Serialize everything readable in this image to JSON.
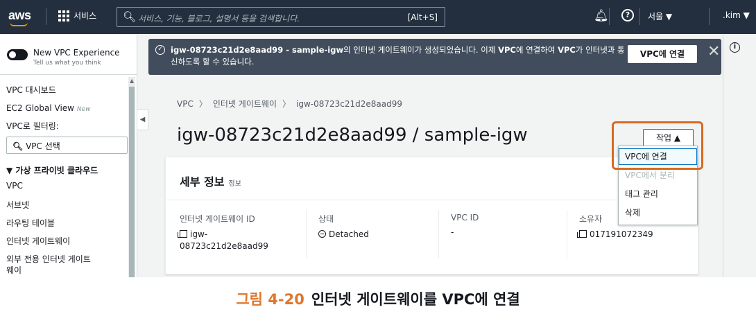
{
  "topnav": {
    "logo": "aws",
    "services": "서비스",
    "search_placeholder": "서비스, 기능, 블로그, 설명서 등을 검색합니다.",
    "search_shortcut": "[Alt+S]",
    "region": "서울 ▼",
    "user": ".kim ▼"
  },
  "sidebar": {
    "toggle_title": "New VPC Experience",
    "toggle_sub": "Tell us what you think",
    "items": [
      {
        "label": "VPC 대시보드"
      },
      {
        "label": "EC2 Global View",
        "badge": "New"
      },
      {
        "label": "VPC로 필터링:"
      }
    ],
    "vpc_select": "VPC 선택",
    "section": "▼ 가상 프라이빗 클라우드",
    "section_items": [
      "VPC",
      "서브넷",
      "라우팅 테이블",
      "인터넷 게이트웨이",
      "외부 전용 인터넷 게이트",
      "웨이"
    ]
  },
  "flash": {
    "message_bold": "igw-08723c21d2e8aad99 - sample-igw",
    "message_rest": "의 인터넷 게이트웨이가 생성되었습니다. 이제 ",
    "message_bold2": "VPC",
    "message_rest2": "에 연결하여 ",
    "message_bold3": "VPC",
    "message_rest3": "가 인터넷과 통신하도록 할 수 있습니다.",
    "attach_button": "VPC에 연결",
    "close": "✕"
  },
  "breadcrumb": [
    "VPC",
    "인터넷 게이트웨이",
    "igw-08723c21d2e8aad99"
  ],
  "breadcrumb_sep": "〉",
  "page_title": "igw-08723c21d2e8aad99 / sample-igw",
  "actions": {
    "label": "작업 ▲",
    "menu": [
      "VPC에 연결",
      "VPC에서 분리",
      "태그 관리",
      "삭제"
    ]
  },
  "details": {
    "title": "세부 정보",
    "info": "정보",
    "columns": [
      {
        "label": "인터넷 게이트웨이 ID",
        "value": "igw-",
        "value2": "08723c21d2e8aad99"
      },
      {
        "label": "상태",
        "value": "Detached"
      },
      {
        "label": "VPC ID",
        "value": "-"
      },
      {
        "label": "소유자",
        "value": "017191072349"
      }
    ]
  },
  "caption": {
    "figure": "그림 4-20",
    "text": "인터넷 게이트웨이를 VPC에 연결"
  },
  "colors": {
    "nav_bg": "#232f3e",
    "flash_bg": "#414d5c",
    "highlight": "#d9691e",
    "caption_accent": "#e0762c"
  }
}
